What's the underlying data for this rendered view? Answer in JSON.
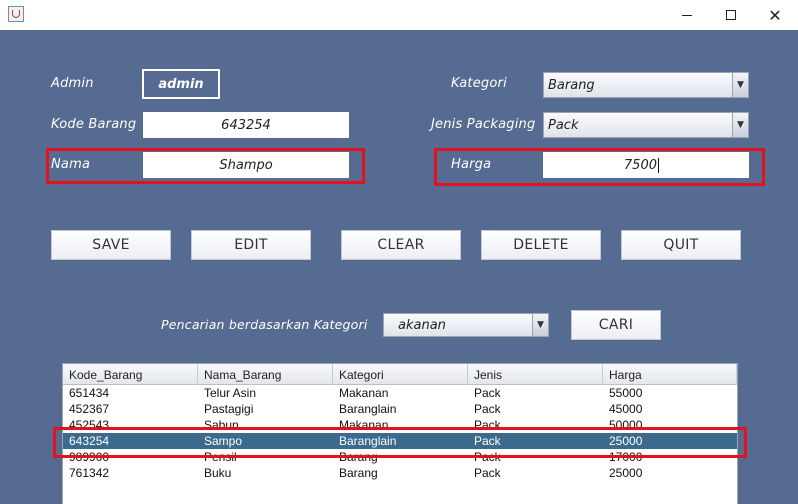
{
  "window": {
    "icon": "java-cup-icon",
    "controls": {
      "minimize": "minimize-icon",
      "maximize": "maximize-icon",
      "close": "✕"
    }
  },
  "form": {
    "admin_label": "Admin",
    "admin_value": "admin",
    "kode_label": "Kode Barang",
    "kode_value": "643254",
    "nama_label": "Nama",
    "nama_value": "Shampo",
    "kategori_label": "Kategori",
    "kategori_value": "Barang",
    "jenis_label": "Jenis Packaging",
    "jenis_value": "Pack",
    "harga_label": "Harga",
    "harga_value": "7500"
  },
  "buttons": {
    "save": "SAVE",
    "edit": "EDIT",
    "clear": "CLEAR",
    "delete": "DELETE",
    "quit": "QUIT"
  },
  "search": {
    "label": "Pencarian berdasarkan Kategori",
    "combo_value": "akanan",
    "button": "CARI"
  },
  "table": {
    "columns": [
      "Kode_Barang",
      "Nama_Barang",
      "Kategori",
      "Jenis",
      "Harga"
    ],
    "rows": [
      [
        "651434",
        "Telur Asin",
        "Makanan",
        "Pack",
        "55000"
      ],
      [
        "452367",
        "Pastagigi",
        "Baranglain",
        "Pack",
        "45000"
      ],
      [
        "452543",
        "Sabun",
        "Makanan",
        "Pack",
        "50000"
      ],
      [
        "643254",
        "Sampo",
        "Baranglain",
        "Pack",
        "25000"
      ],
      [
        "989900",
        "Pensil",
        "Barang",
        "Pack",
        "17000"
      ],
      [
        "761342",
        "Buku",
        "Barang",
        "Pack",
        "25000"
      ]
    ],
    "selected_row": "643254"
  },
  "colors": {
    "panel": "#566b91",
    "highlight": "#e3121d",
    "selected_row": "#3c6a8c"
  }
}
